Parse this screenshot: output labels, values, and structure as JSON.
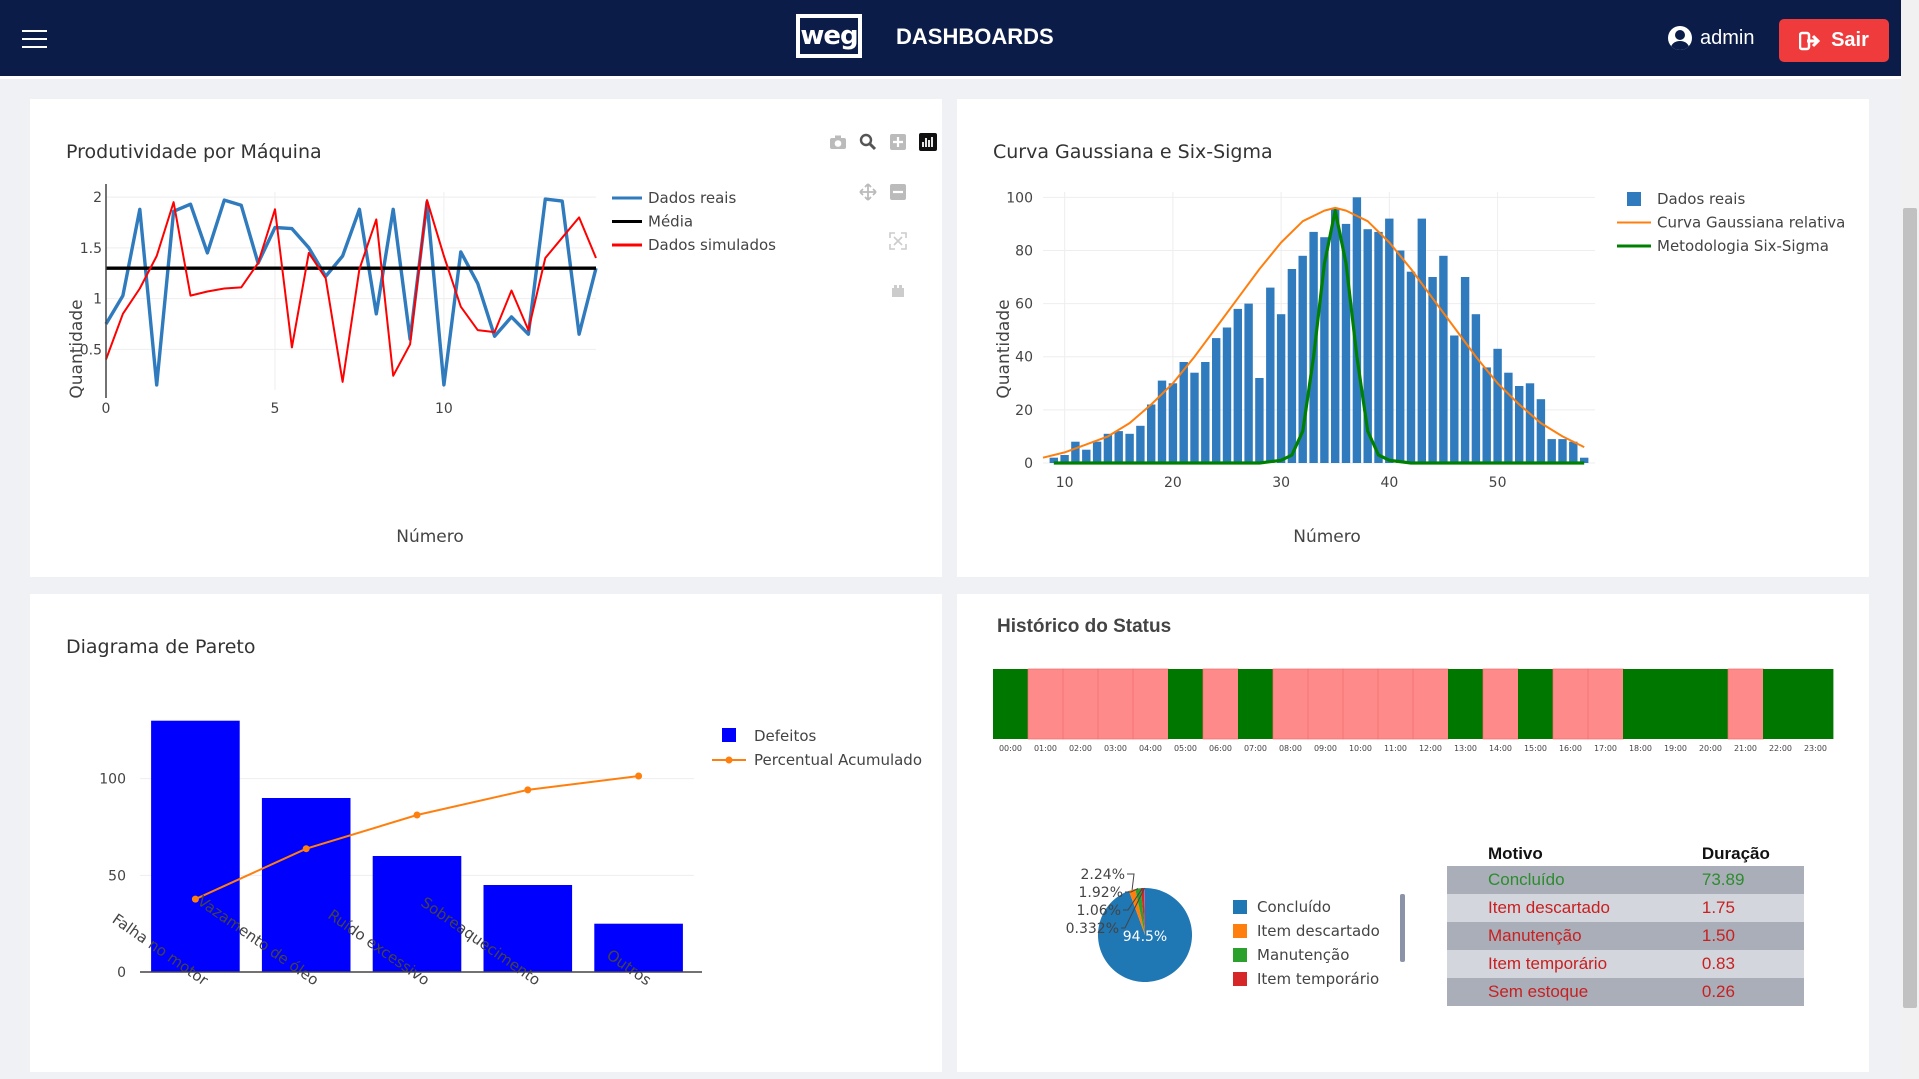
{
  "navbar": {
    "title": "DASHBOARDS",
    "logo_text": "weg",
    "user": "admin",
    "logout_label": "Sair"
  },
  "colors": {
    "navbar": "#0b1c48",
    "logout": "#ef3b3b",
    "blue_series": "#2f7bbd",
    "red_series": "#ff0000",
    "pareto_bars": "#0000ff",
    "pareto_line": "#ff7f0e",
    "status_ok": "#007800",
    "status_fail": "#ff8a8a"
  },
  "charts": {
    "produtividade": {
      "title": "Produtividade por Máquina",
      "modebar_icons": [
        "camera-icon",
        "zoom-icon",
        "zoom-in-icon",
        "bar-chart-icon",
        "pan-icon",
        "zoom-out-icon",
        "autoscale-icon",
        "reset-axes-icon"
      ],
      "chart_data": {
        "type": "line",
        "xlabel": "Número",
        "ylabel": "Quantidade",
        "xlim": [
          0,
          14.5
        ],
        "ylim": [
          0.1,
          2.05
        ],
        "xticks": [
          0,
          5,
          10
        ],
        "yticks": [
          0.5,
          1,
          1.5,
          2
        ],
        "ytick_labels": [
          "0.5",
          "1",
          "1.5",
          "2"
        ],
        "legend_position": "top-right",
        "series": [
          {
            "name": "Dados reais",
            "color": "#2f7bbd",
            "x": [
              0,
              0.5,
              1,
              1.5,
              2,
              2.5,
              3,
              3.5,
              4,
              4.5,
              5,
              5.5,
              6,
              6.5,
              7,
              7.5,
              8,
              8.5,
              9,
              9.5,
              10,
              10.5,
              11,
              11.5,
              12,
              12.5,
              13,
              13.5,
              14,
              14.5
            ],
            "y": [
              0.75,
              1.03,
              1.88,
              0.15,
              1.86,
              1.93,
              1.45,
              1.97,
              1.92,
              1.35,
              1.7,
              1.69,
              1.5,
              1.22,
              1.42,
              1.88,
              0.85,
              1.88,
              0.6,
              1.95,
              0.15,
              1.46,
              1.15,
              0.63,
              0.82,
              0.65,
              1.98,
              1.96,
              0.65,
              1.3
            ]
          },
          {
            "name": "Média",
            "color": "#000000",
            "x": [
              0,
              14.5
            ],
            "y": [
              1.3,
              1.3
            ]
          },
          {
            "name": "Dados simulados",
            "color": "#ff0000",
            "x": [
              0,
              0.5,
              1,
              1.5,
              2,
              2.5,
              3,
              3.5,
              4,
              4.5,
              5,
              5.5,
              6,
              6.5,
              7,
              7.5,
              8,
              8.5,
              9,
              9.5,
              10,
              10.5,
              11,
              11.5,
              12,
              12.5,
              13,
              13.5,
              14,
              14.5
            ],
            "y": [
              0.4,
              0.85,
              1.1,
              1.42,
              1.95,
              1.03,
              1.07,
              1.1,
              1.11,
              1.35,
              1.88,
              0.52,
              1.45,
              1.2,
              0.18,
              1.29,
              1.78,
              0.24,
              0.55,
              1.97,
              1.42,
              0.92,
              0.69,
              0.67,
              1.08,
              0.69,
              1.4,
              1.6,
              1.8,
              1.4
            ]
          }
        ]
      }
    },
    "gaussiana": {
      "title": "Curva Gaussiana e Six-Sigma",
      "chart_data": {
        "type": "bar",
        "xlabel": "Número",
        "ylabel": "Quantidade",
        "xlim": [
          8,
          59
        ],
        "ylim": [
          0,
          102
        ],
        "xticks": [
          10,
          20,
          30,
          40,
          50
        ],
        "yticks": [
          0,
          20,
          40,
          60,
          80,
          100
        ],
        "legend_position": "top-right",
        "series": [
          {
            "name": "Dados reais",
            "color": "#2f7bbd",
            "x": [
              9,
              10,
              11,
              12,
              13,
              14,
              15,
              16,
              17,
              18,
              19,
              20,
              21,
              22,
              23,
              24,
              25,
              26,
              27,
              28,
              29,
              30,
              31,
              32,
              33,
              34,
              35,
              36,
              37,
              38,
              39,
              40,
              41,
              42,
              43,
              44,
              45,
              46,
              47,
              48,
              49,
              50,
              51,
              52,
              53,
              54,
              55,
              56,
              57,
              58
            ],
            "y": [
              2,
              3,
              8,
              5,
              8,
              11,
              12,
              11,
              14,
              22,
              31,
              30,
              38,
              34,
              38,
              47,
              51,
              58,
              60,
              32,
              66,
              56,
              73,
              78,
              87,
              85,
              96,
              90,
              100,
              88,
              87,
              92,
              80,
              72,
              92,
              70,
              78,
              48,
              70,
              56,
              36,
              43,
              34,
              29,
              30,
              24,
              9,
              9,
              8,
              2
            ]
          },
          {
            "name": "Curva Gaussiana relativa",
            "color": "#ff7f0e",
            "x": [
              8,
              10,
              12,
              14,
              16,
              18,
              20,
              22,
              24,
              26,
              28,
              30,
              32,
              34,
              35,
              36,
              38,
              40,
              42,
              44,
              46,
              48,
              50,
              52,
              54,
              56,
              58
            ],
            "y": [
              2,
              4,
              7,
              10,
              15,
              22,
              30,
              40,
              51,
              62,
              73,
              83,
              91,
              95,
              96,
              95,
              91,
              83,
              73,
              62,
              51,
              40,
              30,
              22,
              15,
              10,
              6
            ]
          },
          {
            "name": "Metodologia Six-Sigma",
            "color": "#008000",
            "x": [
              9,
              28,
              30,
              31,
              32,
              33,
              34,
              35,
              36,
              37,
              38,
              39,
              40,
              42,
              58
            ],
            "y": [
              0,
              0,
              1,
              3,
              12,
              40,
              75,
              95,
              75,
              40,
              12,
              3,
              1,
              0,
              0
            ]
          }
        ]
      }
    },
    "pareto": {
      "title": "Diagrama de Pareto",
      "chart_data": {
        "type": "bar",
        "categories": [
          "Falha no motor",
          "Vazamento de óleo",
          "Ruído excessivo",
          "Sobreaquecimento",
          "Outros"
        ],
        "ylim": [
          0,
          135
        ],
        "yticks": [
          0,
          50,
          100
        ],
        "legend_position": "top-right",
        "series": [
          {
            "name": "Defeitos",
            "color": "#0000ff",
            "values": [
              130,
              90,
              60,
              45,
              25
            ]
          },
          {
            "name": "Percentual Acumulado",
            "color": "#ff7f0e",
            "values": [
              37.7,
              63.8,
              81.2,
              94.2,
              101.4
            ]
          }
        ]
      }
    }
  },
  "status": {
    "title": "Histórico do Status",
    "hours": [
      "00:00",
      "01:00",
      "02:00",
      "03:00",
      "04:00",
      "05:00",
      "06:00",
      "07:00",
      "08:00",
      "09:00",
      "10:00",
      "11:00",
      "12:00",
      "13:00",
      "14:00",
      "15:00",
      "16:00",
      "17:00",
      "18:00",
      "19:00",
      "20:00",
      "21:00",
      "22:00",
      "23:00"
    ],
    "states": [
      "ok",
      "fail",
      "fail",
      "fail",
      "fail",
      "ok",
      "fail",
      "ok",
      "fail",
      "fail",
      "fail",
      "fail",
      "fail",
      "ok",
      "fail",
      "ok",
      "fail",
      "fail",
      "ok",
      "ok",
      "ok",
      "fail",
      "ok",
      "ok"
    ],
    "pie": {
      "chart_data": {
        "type": "pie",
        "labels": [
          "Concluído",
          "Item descartado",
          "Manutenção",
          "Item temporário"
        ],
        "values": [
          94.5,
          2.24,
          1.92,
          1.06,
          0.332
        ],
        "value_labels": [
          "94.5%",
          "2.24%",
          "1.92%",
          "1.06%",
          "0.332%"
        ],
        "colors": [
          "#1f77b4",
          "#ff7f0e",
          "#2ca02c",
          "#d62728",
          "#9467bd"
        ]
      }
    },
    "table": {
      "headers": [
        "Motivo",
        "Duração"
      ],
      "rows": [
        {
          "motivo": "Concluído",
          "duracao": "73.89",
          "color": "#2e8b2e"
        },
        {
          "motivo": "Item descartado",
          "duracao": "1.75",
          "color": "#c82020"
        },
        {
          "motivo": "Manutenção",
          "duracao": "1.50",
          "color": "#c82020"
        },
        {
          "motivo": "Item temporário",
          "duracao": "0.83",
          "color": "#c82020"
        },
        {
          "motivo": "Sem estoque",
          "duracao": "0.26",
          "color": "#c82020"
        }
      ]
    }
  }
}
